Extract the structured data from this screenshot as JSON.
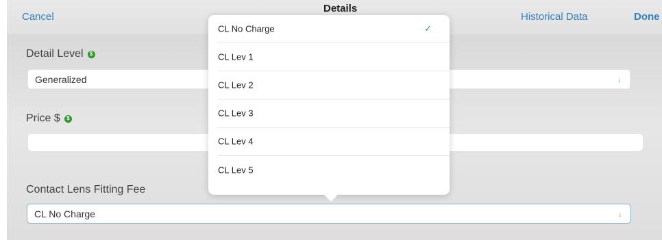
{
  "navbar": {
    "cancel_label": "Cancel",
    "title": "Details",
    "historical_label": "Historical Data",
    "done_label": "Done"
  },
  "form": {
    "detail_level": {
      "label": "Detail Level",
      "value": "Generalized"
    },
    "price": {
      "label": "Price $",
      "value": ""
    },
    "fitting_fee": {
      "label": "Contact Lens Fitting Fee",
      "value": "CL No Charge"
    }
  },
  "dropdown": {
    "options": [
      {
        "label": "CL No Charge",
        "selected": true
      },
      {
        "label": "CL Lev 1",
        "selected": false
      },
      {
        "label": "CL Lev 2",
        "selected": false
      },
      {
        "label": "CL Lev 3",
        "selected": false
      },
      {
        "label": "CL Lev 4",
        "selected": false
      },
      {
        "label": "CL Lev 5",
        "selected": false
      }
    ],
    "check_glyph": "✓"
  },
  "icons": {
    "dollar_glyph": "$",
    "dropdown_arrow_glyph": "↓"
  },
  "colors": {
    "accent": "#2f7fc1",
    "info_icon": "#2c9a2c",
    "dropdown_arrow": "#6fb26f"
  }
}
